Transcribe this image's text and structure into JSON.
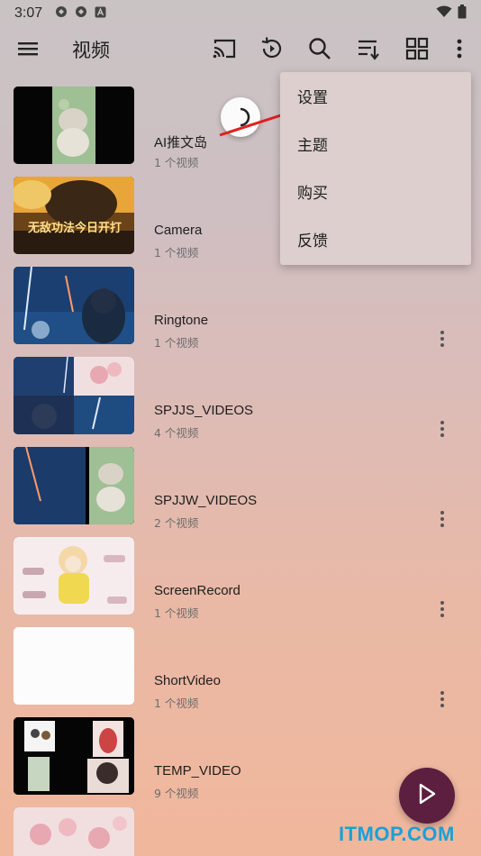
{
  "status_bar": {
    "time": "3:07",
    "icons": [
      "shield-icon",
      "shield-icon",
      "a-badge-icon"
    ],
    "right_icons": [
      "wifi-icon",
      "battery-icon"
    ]
  },
  "toolbar": {
    "title": "视频",
    "icons": [
      "menu-icon",
      "cast-icon",
      "history-icon",
      "search-icon",
      "sort-icon",
      "grid-view-icon",
      "overflow-menu-icon"
    ]
  },
  "menu": {
    "items": [
      "设置",
      "主题",
      "购买",
      "反馈"
    ]
  },
  "folders": [
    {
      "name": "AI推文岛",
      "count": "1 个视频"
    },
    {
      "name": "Camera",
      "count": "1 个视频"
    },
    {
      "name": "Ringtone",
      "count": "1 个视频"
    },
    {
      "name": "SPJJS_VIDEOS",
      "count": "4 个视频"
    },
    {
      "name": "SPJJW_VIDEOS",
      "count": "2 个视频"
    },
    {
      "name": "ScreenRecord",
      "count": "1 个视频"
    },
    {
      "name": "ShortVideo",
      "count": "1 个视频"
    },
    {
      "name": "TEMP_VIDEO",
      "count": "9 个视频"
    }
  ],
  "thumb_texts": {
    "camera_banner": "无敌功法今日开打"
  },
  "fab": {
    "icon": "play-icon"
  },
  "watermark": "ITMOP.COM",
  "colors": {
    "accent": "#5c1f3f",
    "watermark": "#1d9fd6",
    "arrow": "#e02020"
  }
}
